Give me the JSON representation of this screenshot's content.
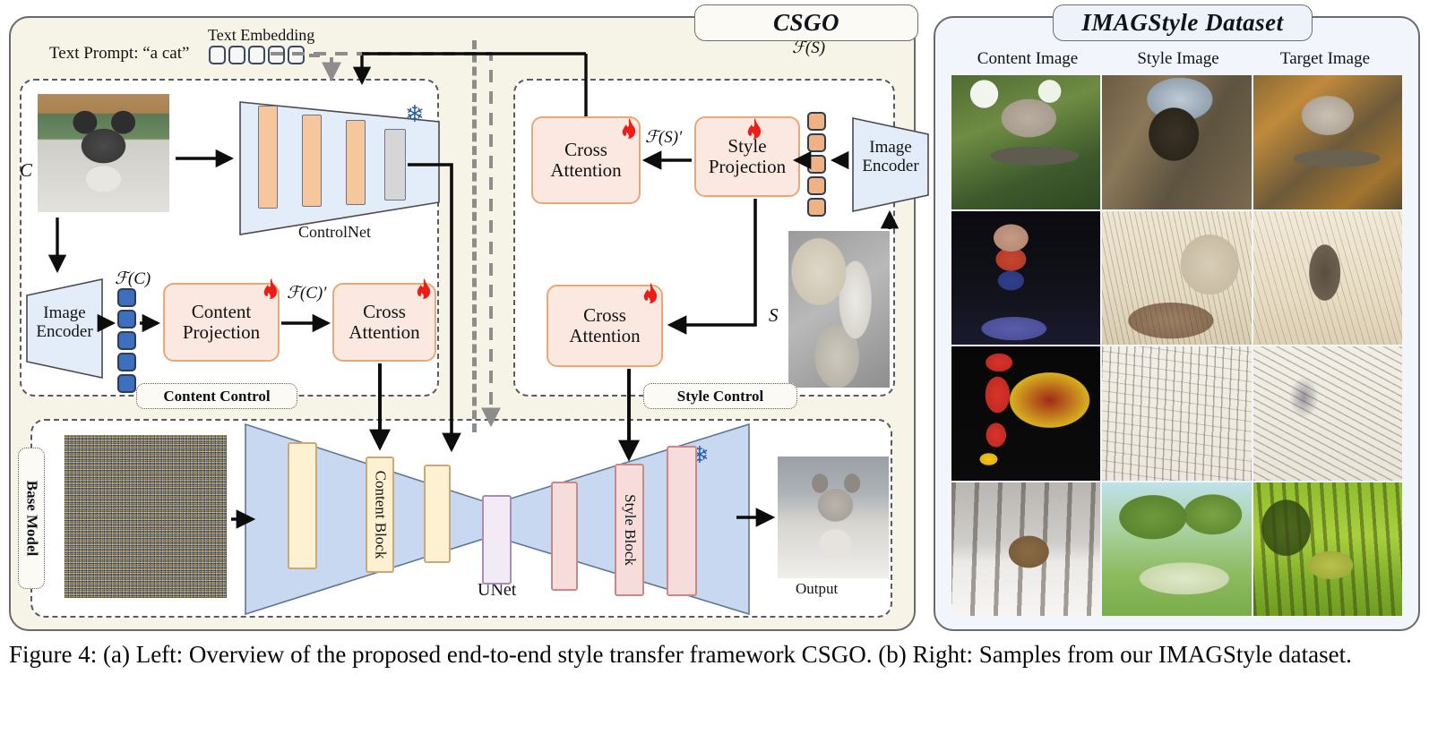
{
  "figure": {
    "caption": "Figure 4: (a) Left: Overview of the proposed end-to-end style transfer framework CSGO. (b) Right: Samples from our IMAGStyle dataset."
  },
  "left_panel": {
    "title": "CSGO",
    "prompt": {
      "prompt_label": "Text Prompt: “a cat”",
      "embedding_label": "Text Embedding",
      "embedding_token_count": 5
    },
    "content_control": {
      "group_label": "Content  Control",
      "input_symbol": "C",
      "image_encoder": "Image\nEncoder",
      "feature_label": "ℱ(C)",
      "feature_prime_label": "ℱ(C)′",
      "modules": [
        {
          "label": "Content\nProjection",
          "trainable": true
        },
        {
          "label": "Cross\nAttention",
          "trainable": true
        }
      ],
      "token_count": 5,
      "token_color": "#3e6fbf"
    },
    "controlnet": {
      "label": "ControlNet",
      "frozen": true,
      "bar_count": 4
    },
    "style_control": {
      "group_label": "Style Control",
      "input_symbol": "S",
      "image_encoder": "Image\nEncoder",
      "feature_label": "ℱ(S)",
      "feature_prime_label": "ℱ(S)′",
      "modules": [
        {
          "label": "Style\nProjection",
          "trainable": true
        },
        {
          "label": "Cross\nAttention",
          "trainable": true
        },
        {
          "label": "Cross\nAttention",
          "trainable": true
        }
      ],
      "token_count": 5,
      "token_color": "#f0b183"
    },
    "base_model": {
      "group_label": "Base Model",
      "unet_label": "UNet",
      "frozen": true,
      "content_block_label": "Content Block",
      "style_block_label": "Style Block",
      "output_label": "Output"
    }
  },
  "right_panel": {
    "title": "IMAGStyle Dataset",
    "columns": [
      "Content Image",
      "Style Image",
      "Target Image"
    ],
    "rows": [
      {
        "content": "bird-on-branch-photo",
        "style": "stone-bridge-painting",
        "target": "bird-stylized-painting"
      },
      {
        "content": "child-on-scooter-photo",
        "style": "victorian-street-engraving",
        "target": "child-scooter-engraving"
      },
      {
        "content": "flash-toy-figure-photo",
        "style": "tree-pencil-sketch",
        "target": "child-running-pencil-sketch"
      },
      {
        "content": "deer-in-snow-photo",
        "style": "green-park-impressionist",
        "target": "zebra-green-impressionist"
      }
    ]
  },
  "colors": {
    "panel_cream": "#f6f3e7",
    "panel_blue": "#f2f6fc",
    "module_fill": "#fbe9e1",
    "module_border": "#e8a878",
    "trapezoid_fill": "#e2edf9",
    "trapezoid_border": "#5e7794",
    "content_token": "#3e6fbf",
    "style_token": "#f0b183",
    "flame": "#ee1c16",
    "snowflake": "#2a5fa8"
  }
}
